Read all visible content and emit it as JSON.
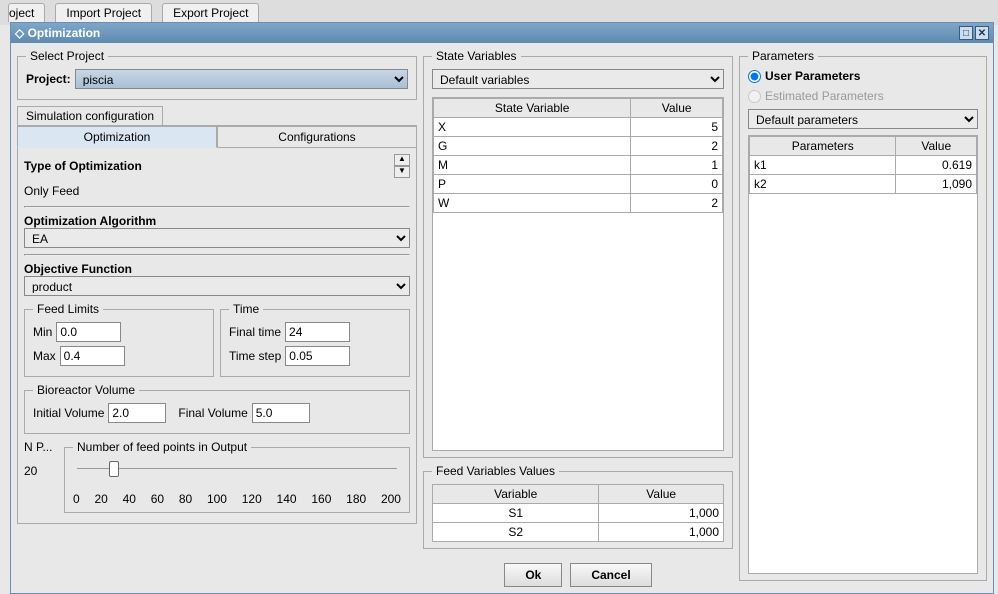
{
  "bg_tabs": {
    "t0": "oject",
    "t1": "Import Project",
    "t2": "Export Project"
  },
  "window": {
    "title": "Optimization"
  },
  "select_project": {
    "legend": "Select Project",
    "label": "Project:",
    "value": "piscia"
  },
  "sim_group": "Simulation configuration",
  "tabs": {
    "opt": "Optimization",
    "conf": "Configurations"
  },
  "opt_panel": {
    "type_label": "Type of Optimization",
    "type_value": "Only Feed",
    "algo_label": "Optimization Algorithm",
    "algo_value": "EA",
    "obj_label": "Objective Function",
    "obj_value": "product"
  },
  "feed_limits": {
    "legend": "Feed Limits",
    "min_lbl": "Min",
    "min": "0.0",
    "max_lbl": "Max",
    "max": "0.4"
  },
  "time": {
    "legend": "Time",
    "final_lbl": "Final time",
    "final": "24",
    "step_lbl": "Time step",
    "step": "0.05"
  },
  "bio": {
    "legend": "Bioreactor Volume",
    "init_lbl": "Initial Volume",
    "init": "2.0",
    "final_lbl": "Final Volume",
    "final": "5.0"
  },
  "npoints": {
    "short": "N P...",
    "label": "Number of feed points in Output",
    "value": "20",
    "ticks": [
      "0",
      "20",
      "40",
      "60",
      "80",
      "100",
      "120",
      "140",
      "160",
      "180",
      "200"
    ]
  },
  "state_vars": {
    "legend": "State Variables",
    "select": "Default variables",
    "head_var": "State Variable",
    "head_val": "Value",
    "rows": [
      {
        "n": "X",
        "v": "5"
      },
      {
        "n": "G",
        "v": "2"
      },
      {
        "n": "M",
        "v": "1"
      },
      {
        "n": "P",
        "v": "0"
      },
      {
        "n": "W",
        "v": "2"
      }
    ]
  },
  "feed_vals": {
    "legend": "Feed Variables Values",
    "head_var": "Variable",
    "head_val": "Value",
    "rows": [
      {
        "n": "S1",
        "v": "1,000"
      },
      {
        "n": "S2",
        "v": "1,000"
      }
    ]
  },
  "params": {
    "legend": "Parameters",
    "user": "User Parameters",
    "est": "Estimated Parameters",
    "select": "Default parameters",
    "head_par": "Parameters",
    "head_val": "Value",
    "rows": [
      {
        "n": "k1",
        "v": "0.619"
      },
      {
        "n": "k2",
        "v": "1,090"
      }
    ]
  },
  "buttons": {
    "ok": "Ok",
    "cancel": "Cancel"
  }
}
